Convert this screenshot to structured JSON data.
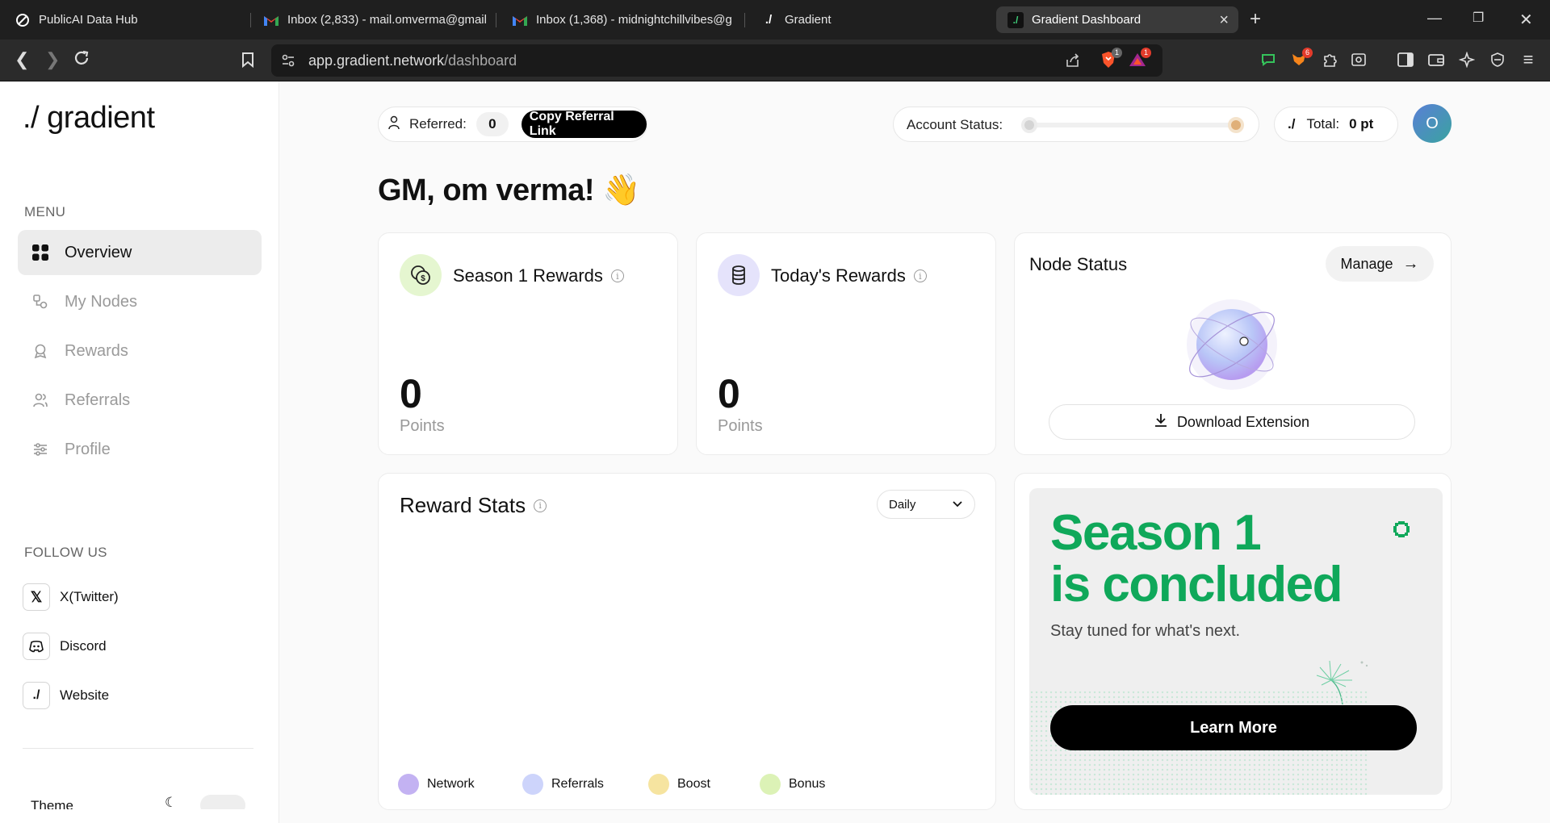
{
  "browser": {
    "tabs": [
      {
        "title": "PublicAI Data Hub"
      },
      {
        "title": "Inbox (2,833) - mail.omverma@gmail"
      },
      {
        "title": "Inbox (1,368) - midnightchillvibes@g"
      },
      {
        "title": "Gradient"
      },
      {
        "title": "Gradient Dashboard"
      }
    ],
    "url_host": "app.gradient.network",
    "url_path": "/dashboard",
    "ext_badge_brave": "1",
    "ext_badge_alert": "1",
    "ext_badge_count": "6"
  },
  "sidebar": {
    "logo": "./ gradient",
    "menu_title": "MENU",
    "menu": [
      {
        "label": "Overview",
        "icon": "grid-icon"
      },
      {
        "label": "My Nodes",
        "icon": "nodes-icon"
      },
      {
        "label": "Rewards",
        "icon": "award-icon"
      },
      {
        "label": "Referrals",
        "icon": "users-icon"
      },
      {
        "label": "Profile",
        "icon": "sliders-icon"
      }
    ],
    "follow_title": "FOLLOW US",
    "follow": [
      {
        "label": "X(Twitter)",
        "icon": "x-icon"
      },
      {
        "label": "Discord",
        "icon": "discord-icon"
      },
      {
        "label": "Website",
        "icon": "gradient-icon"
      }
    ],
    "theme_label": "Theme"
  },
  "header": {
    "referred_label": "Referred:",
    "referred_count": "0",
    "copy_link": "Copy Referral Link",
    "account_status_label": "Account Status:",
    "total_label": "Total:",
    "total_value": "0 pt",
    "avatar_initial": "O"
  },
  "greeting": "GM, om verma! 👋",
  "season_rewards": {
    "title": "Season 1 Rewards",
    "value": "0",
    "unit": "Points"
  },
  "today_rewards": {
    "title": "Today's Rewards",
    "value": "0",
    "unit": "Points"
  },
  "node_status": {
    "title": "Node Status",
    "manage": "Manage",
    "download": "Download Extension"
  },
  "reward_stats": {
    "title": "Reward Stats",
    "period": "Daily",
    "legend": [
      {
        "label": "Network",
        "color": "#c3b2f2"
      },
      {
        "label": "Referrals",
        "color": "#cdd4fb"
      },
      {
        "label": "Boost",
        "color": "#f6e4a0"
      },
      {
        "label": "Bonus",
        "color": "#dcf2b6"
      }
    ]
  },
  "season_banner": {
    "line1": "Season 1",
    "line2": "is concluded",
    "subtitle": "Stay tuned for what's next.",
    "button": "Learn More",
    "accent": "#0fa85a"
  }
}
